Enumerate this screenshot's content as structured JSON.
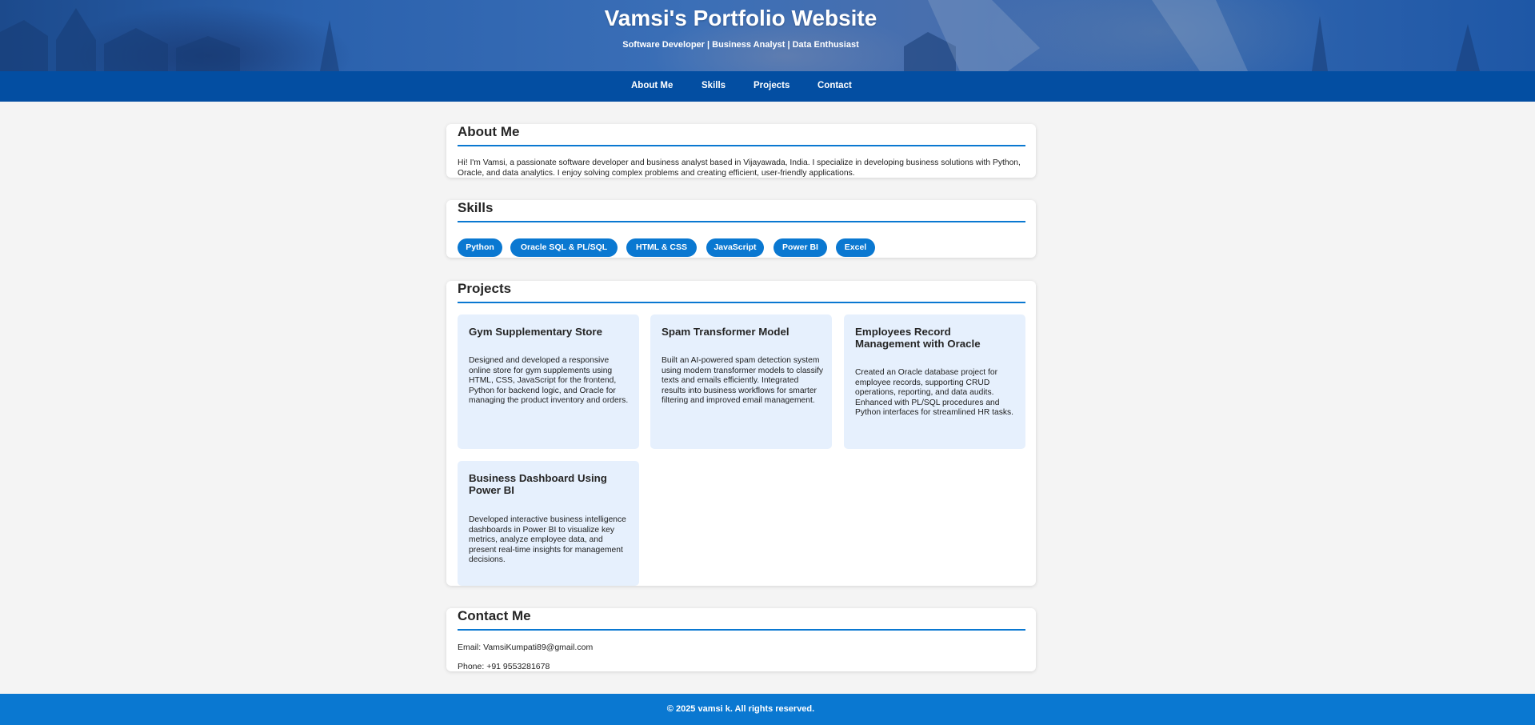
{
  "header": {
    "title": "Vamsi's Portfolio Website",
    "subtitle": "Software Developer | Business Analyst | Data Enthusiast"
  },
  "nav": {
    "items": [
      {
        "label": "About Me"
      },
      {
        "label": "Skills"
      },
      {
        "label": "Projects"
      },
      {
        "label": "Contact"
      }
    ]
  },
  "about": {
    "heading": "About Me",
    "text": "Hi! I'm Vamsi, a passionate software developer and business analyst based in Vijayawada, India. I specialize in developing business solutions with Python, Oracle, and data analytics. I enjoy solving complex problems and creating efficient, user-friendly applications."
  },
  "skills": {
    "heading": "Skills",
    "items": [
      "Python",
      "Oracle SQL & PL/SQL",
      "HTML & CSS",
      "JavaScript",
      "Power BI",
      "Excel"
    ]
  },
  "projects": {
    "heading": "Projects",
    "items": [
      {
        "title": "Gym Supplementary Store",
        "description": "Designed and developed a responsive online store for gym supplements using HTML, CSS, JavaScript for the frontend, Python for backend logic, and Oracle for managing the product inventory and orders."
      },
      {
        "title": "Spam Transformer Model",
        "description": "Built an AI-powered spam detection system using modern transformer models to classify texts and emails efficiently. Integrated results into business workflows for smarter filtering and improved email management."
      },
      {
        "title": "Employees Record Management with Oracle",
        "description": "Created an Oracle database project for employee records, supporting CRUD operations, reporting, and data audits. Enhanced with PL/SQL procedures and Python interfaces for streamlined HR tasks."
      },
      {
        "title": "Business Dashboard Using Power BI",
        "description": "Developed interactive business intelligence dashboards in Power BI to visualize key metrics, analyze employee data, and present real-time insights for management decisions."
      }
    ]
  },
  "contact": {
    "heading": "Contact Me",
    "email": "Email: VamsiKumpati89@gmail.com",
    "phone": "Phone: +91 9553281678"
  },
  "footer": {
    "text": "© 2025 vamsi k. All rights reserved."
  },
  "colors": {
    "nav_bg": "#034ea2",
    "accent": "#0a78d1",
    "project_card_bg": "#e6f0fd",
    "page_bg": "#f4f4f4"
  }
}
